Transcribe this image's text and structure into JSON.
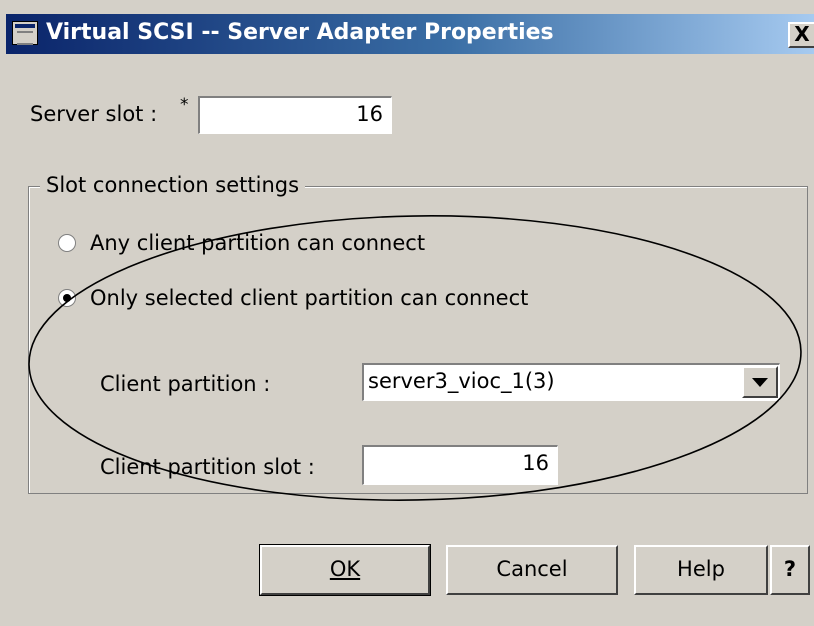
{
  "window": {
    "title": "Virtual SCSI -- Server Adapter Properties",
    "close_label": "X"
  },
  "server_slot": {
    "label": "Server slot :",
    "required_mark": "*",
    "value": "16"
  },
  "slot_connection": {
    "legend": "Slot connection settings",
    "options": [
      {
        "label": "Any client partition can connect",
        "selected": false
      },
      {
        "label": "Only selected client partition can connect",
        "selected": true
      }
    ],
    "client_partition": {
      "label": "Client partition :",
      "selected_value": "server3_vioc_1(3)"
    },
    "client_partition_slot": {
      "label": "Client partition slot :",
      "value": "16"
    }
  },
  "buttons": {
    "ok": "OK",
    "cancel": "Cancel",
    "help": "Help",
    "context_help": "?"
  },
  "colors": {
    "title_bar_start": "#0a246a",
    "title_bar_end": "#a6caf0",
    "dialog_face": "#d4d0c8"
  }
}
